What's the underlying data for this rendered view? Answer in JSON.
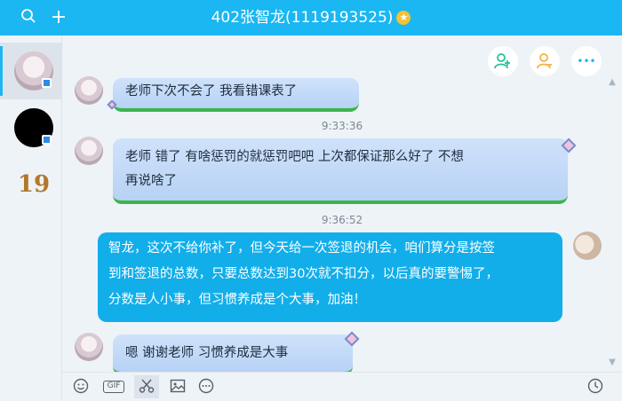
{
  "title_bar": {
    "title": "402张智龙(1119193525)",
    "search_icon": "search-icon",
    "plus_icon": "plus-icon",
    "star_glyph": "★"
  },
  "sidebar": {
    "items": [
      {
        "name": "contact-anime-boy",
        "active": true
      },
      {
        "name": "contact-black-circle",
        "active": false
      },
      {
        "name": "contact-19",
        "label": "19"
      }
    ]
  },
  "actions": {
    "more_label": "•••"
  },
  "messages": [
    {
      "side": "in",
      "text": "老师下次不会了    我看错课表了"
    },
    {
      "time": "9:33:36"
    },
    {
      "side": "in",
      "line1": "老师  错了       有啥惩罚的就惩罚吧吧      上次都保证那么好了   不想",
      "line2": "再说啥了"
    },
    {
      "time": "9:36:52"
    },
    {
      "side": "out",
      "line1": "智龙，这次不给你补了，但今天给一次签退的机会，咱们算分是按签",
      "line2": "到和签退的总数，只要总数达到30次就不扣分，以后真的要警惕了，",
      "line3": "分数是人小事，但习惯养成是个大事，加油！"
    },
    {
      "side": "in",
      "text": "嗯  谢谢老师     习惯养成是大事"
    }
  ],
  "input_toolbar": {
    "gif_label": "GIF",
    "icons": [
      "emoji-icon",
      "gif-icon",
      "scissors-icon",
      "image-icon",
      "more-icon",
      "history-icon"
    ]
  },
  "colors": {
    "title_bar": "#1ab7f2",
    "incoming_bubble": "#b7d2f5",
    "outgoing_bubble": "#12aeea",
    "bubble_underline": "#3bb54a"
  }
}
